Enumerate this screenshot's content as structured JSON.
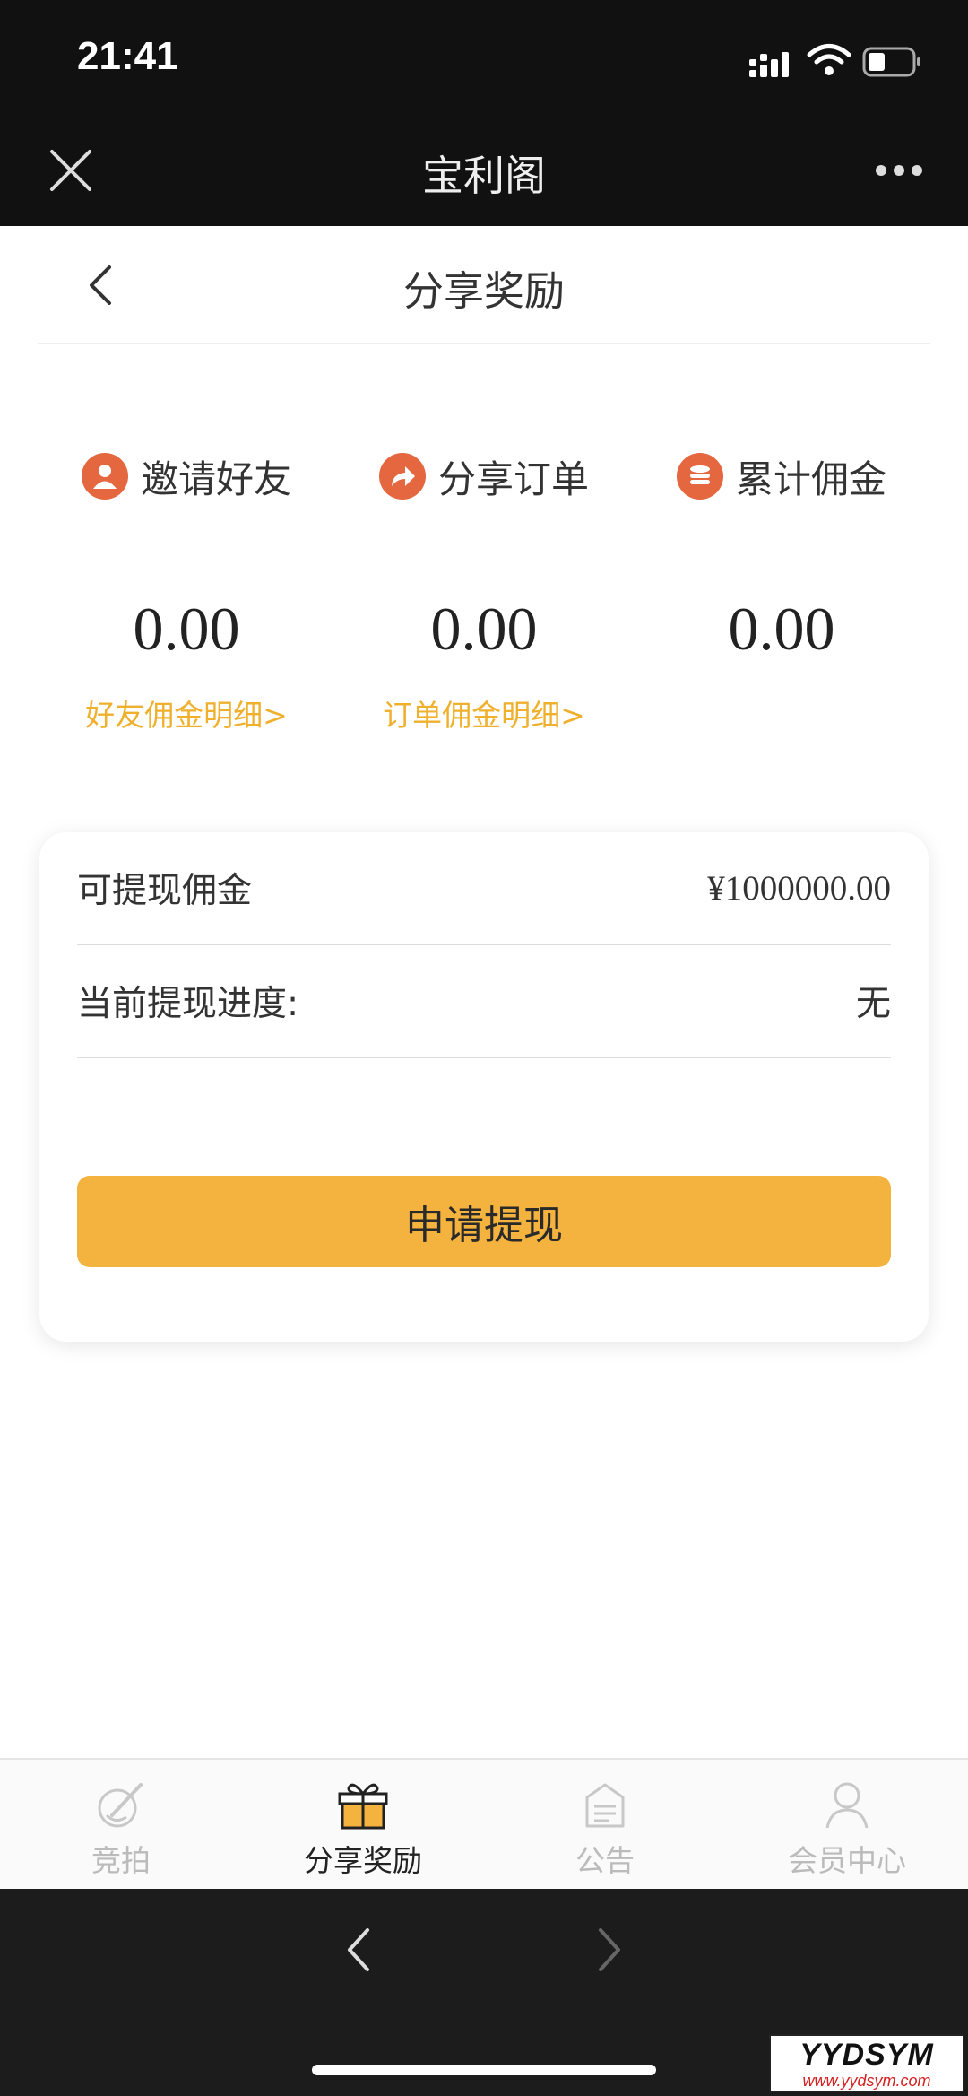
{
  "status_bar": {
    "time": "21:41"
  },
  "wechat_bar": {
    "title": "宝利阁"
  },
  "page": {
    "title": "分享奖励"
  },
  "stats": [
    {
      "label": "邀请好友",
      "icon": "invite-friends-icon",
      "value": "0.00",
      "link": "好友佣金明细>"
    },
    {
      "label": "分享订单",
      "icon": "share-order-icon",
      "value": "0.00",
      "link": "订单佣金明细>"
    },
    {
      "label": "累计佣金",
      "icon": "coins-icon",
      "value": "0.00",
      "link": ""
    }
  ],
  "withdraw": {
    "available_label": "可提现佣金",
    "available_value": "¥1000000.00",
    "progress_label": "当前提现进度:",
    "progress_value": "无",
    "button_label": "申请提现"
  },
  "nav": [
    {
      "label": "竞拍",
      "icon": "auction-icon",
      "active": false
    },
    {
      "label": "分享奖励",
      "icon": "gift-icon",
      "active": true
    },
    {
      "label": "公告",
      "icon": "notice-icon",
      "active": false
    },
    {
      "label": "会员中心",
      "icon": "user-icon",
      "active": false
    }
  ],
  "watermark": {
    "main": "YYDSYM",
    "sub": "www.yydsym.com"
  },
  "colors": {
    "accent": "#f4b33e",
    "link": "#efb02e",
    "icon_bg": "#e4673f",
    "dark_bar": "#111111"
  }
}
